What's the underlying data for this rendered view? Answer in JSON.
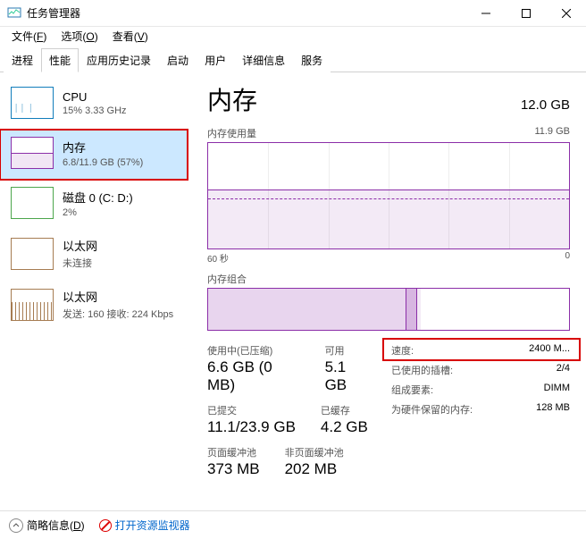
{
  "window": {
    "title": "任务管理器"
  },
  "menu": {
    "file": "文件(F)",
    "file_key": "F",
    "options": "选项(O)",
    "options_key": "O",
    "view": "查看(V)",
    "view_key": "V"
  },
  "tabs": [
    "进程",
    "性能",
    "应用历史记录",
    "启动",
    "用户",
    "详细信息",
    "服务"
  ],
  "active_tab": 1,
  "sidebar": {
    "items": [
      {
        "name": "CPU",
        "detail": "15% 3.33 GHz",
        "kind": "cpu"
      },
      {
        "name": "内存",
        "detail": "6.8/11.9 GB (57%)",
        "kind": "mem",
        "selected": true
      },
      {
        "name": "磁盘 0 (C: D:)",
        "detail": "2%",
        "kind": "disk"
      },
      {
        "name": "以太网",
        "detail": "未连接",
        "kind": "eth1"
      },
      {
        "name": "以太网",
        "detail": "发送: 160 接收: 224 Kbps",
        "kind": "eth2"
      }
    ]
  },
  "main": {
    "title": "内存",
    "capacity": "12.0 GB",
    "usage_label": "内存使用量",
    "usage_max": "11.9 GB",
    "axis_left": "60 秒",
    "axis_right": "0",
    "compo_label": "内存组合",
    "stats": {
      "in_use_label": "使用中(已压缩)",
      "in_use_value": "6.6 GB (0 MB)",
      "avail_label": "可用",
      "avail_value": "5.1 GB",
      "committed_label": "已提交",
      "committed_value": "11.1/23.9 GB",
      "cached_label": "已缓存",
      "cached_value": "4.2 GB",
      "paged_label": "页面缓冲池",
      "paged_value": "373 MB",
      "nonpaged_label": "非页面缓冲池",
      "nonpaged_value": "202 MB"
    },
    "kv": {
      "speed_k": "速度:",
      "speed_v": "2400 M...",
      "slots_k": "已使用的插槽:",
      "slots_v": "2/4",
      "form_k": "组成要素:",
      "form_v": "DIMM",
      "reserved_k": "为硬件保留的内存:",
      "reserved_v": "128 MB"
    }
  },
  "footer": {
    "fewer": "简略信息(D)",
    "resmon": "打开资源监视器"
  },
  "chart_data": {
    "type": "area",
    "title": "内存使用量",
    "ylabel": "GB",
    "ylim": [
      0,
      11.9
    ],
    "x_range_seconds": 60,
    "series": [
      {
        "name": "使用中",
        "approx_value_gb": 6.8
      },
      {
        "name": "已提交",
        "approx_value_gb": 6.0
      }
    ],
    "composition_segments_pct": {
      "in_use": 55,
      "modified": 3,
      "standby": 1,
      "free": 41
    }
  }
}
